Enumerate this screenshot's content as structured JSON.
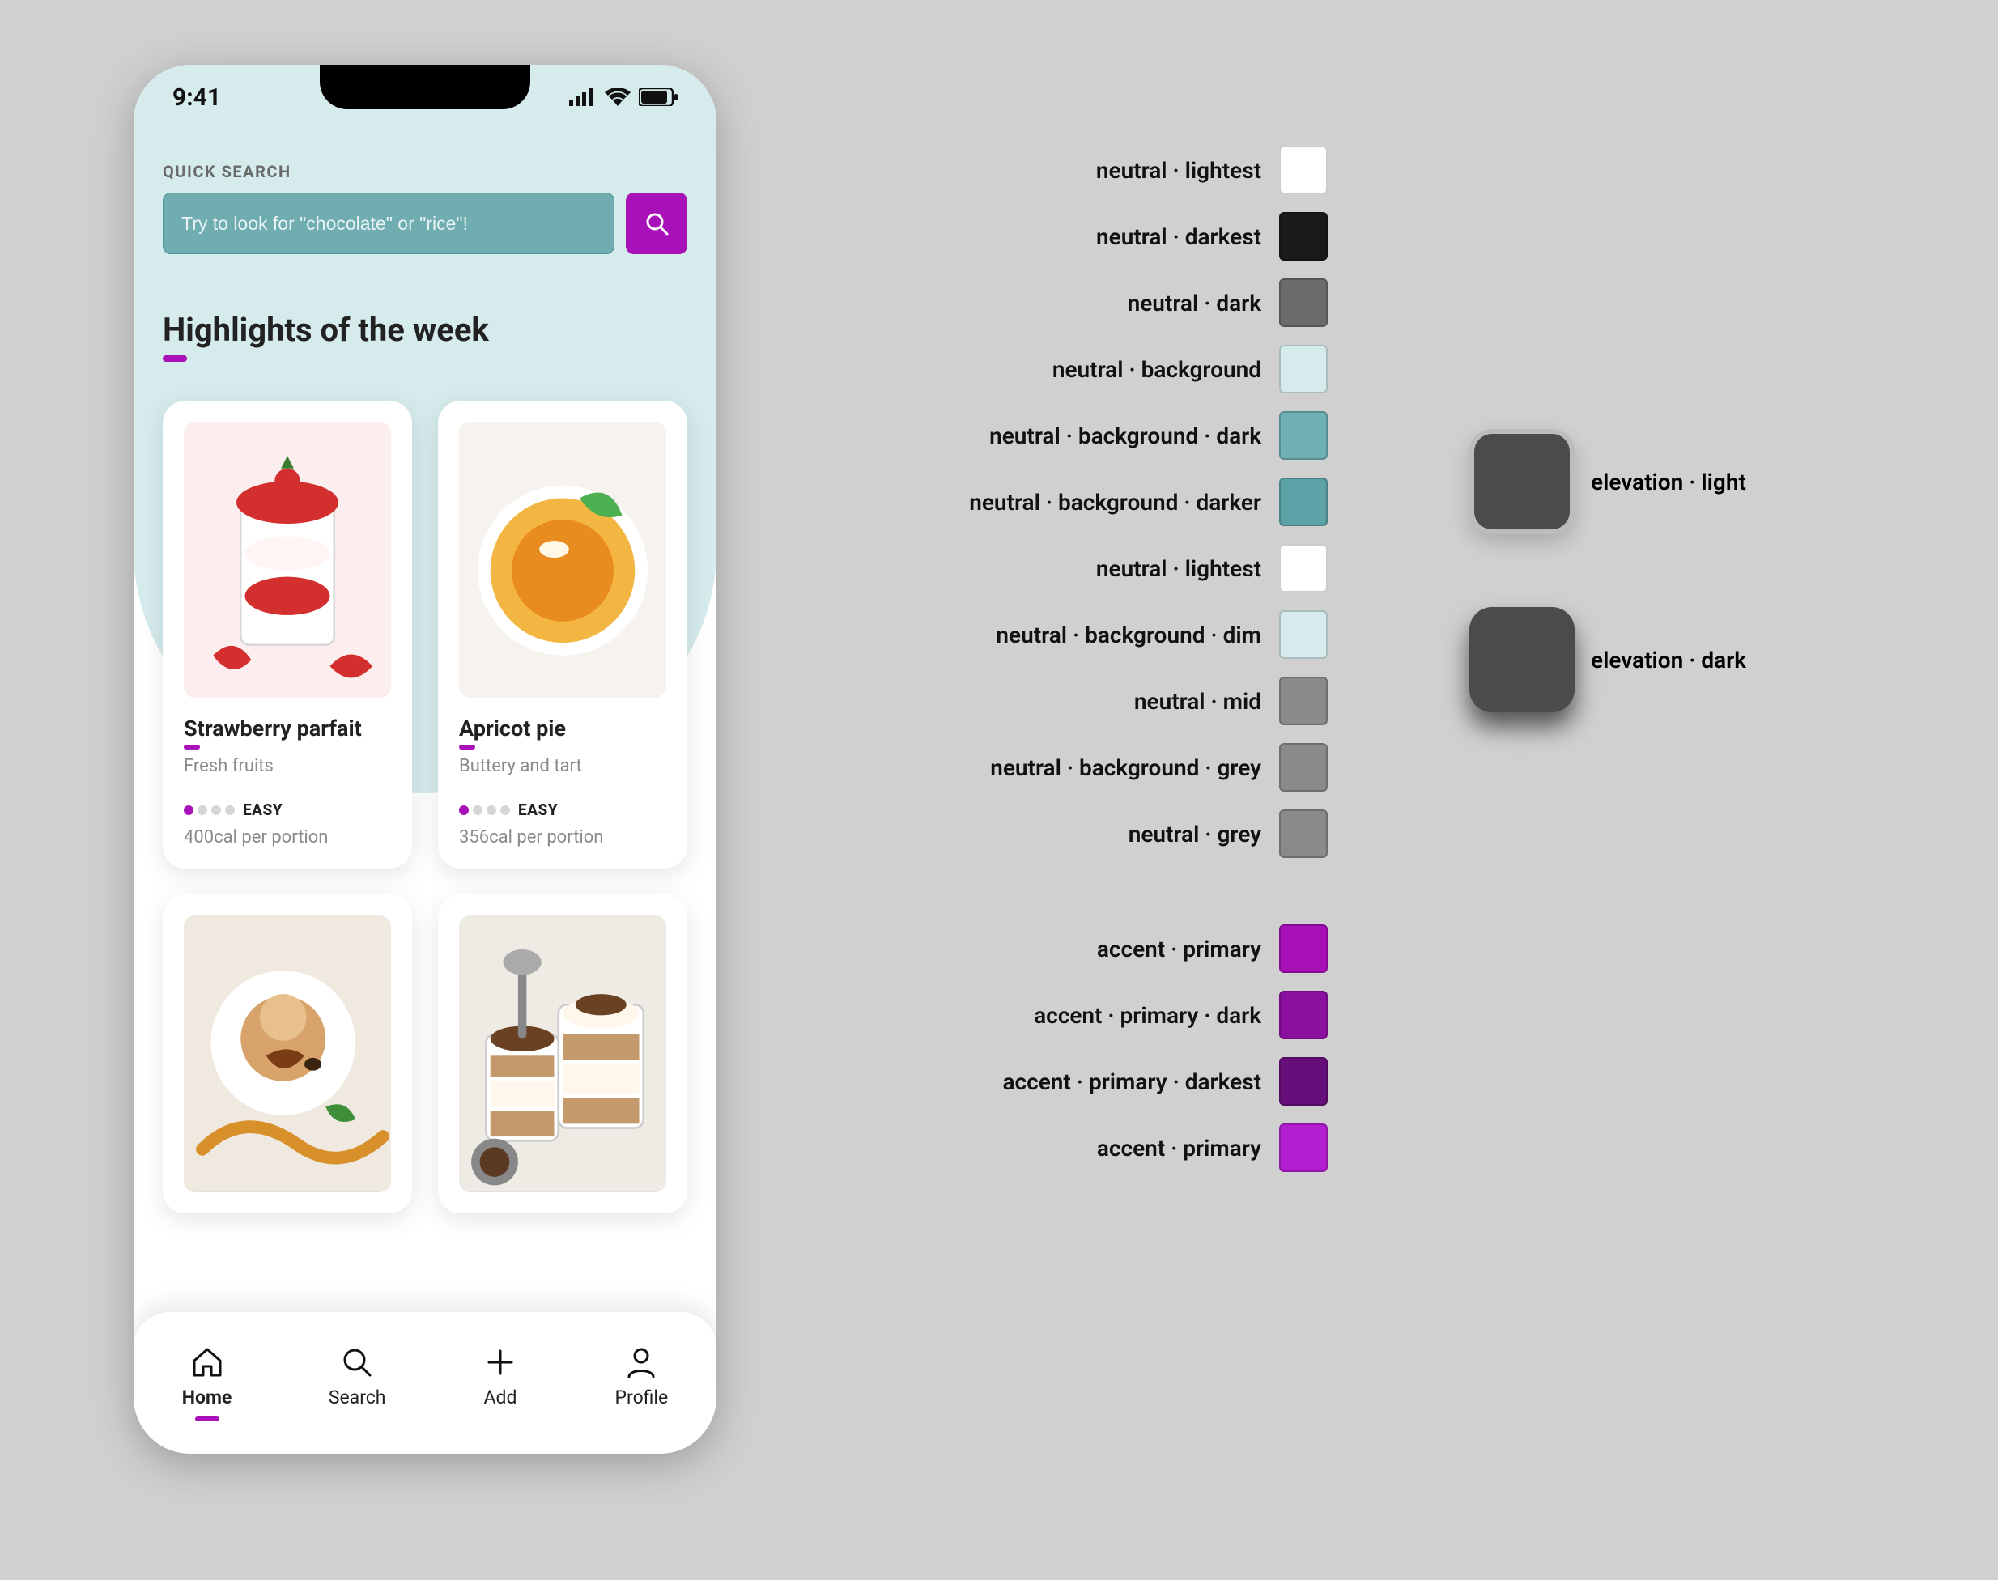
{
  "status": {
    "time": "9:41"
  },
  "search": {
    "label": "QUICK SEARCH",
    "placeholder": "Try to look for \"chocolate\" or \"rice\"!"
  },
  "section_title": "Highlights of the week",
  "cards": [
    {
      "title": "Strawberry parfait",
      "subtitle": "Fresh fruits",
      "difficulty_label": "EASY",
      "difficulty_dots": 1,
      "calories": "400cal per portion"
    },
    {
      "title": "Apricot pie",
      "subtitle": "Buttery and tart",
      "difficulty_label": "EASY",
      "difficulty_dots": 1,
      "calories": "356cal per portion"
    },
    {
      "title": "",
      "subtitle": "",
      "difficulty_label": "",
      "difficulty_dots": 0,
      "calories": ""
    },
    {
      "title": "",
      "subtitle": "",
      "difficulty_label": "",
      "difficulty_dots": 0,
      "calories": ""
    }
  ],
  "tabs": [
    {
      "label": "Home",
      "active": true
    },
    {
      "label": "Search",
      "active": false
    },
    {
      "label": "Add",
      "active": false
    },
    {
      "label": "Profile",
      "active": false
    }
  ],
  "palette": {
    "neutral.lightest": "#ffffff",
    "neutral.darkest": "#1a1a1a",
    "neutral.dark": "#6b6b6b",
    "neutral.background.original": "#d5ebec",
    "neutral.background.dark": "#6fb0b4",
    "neutral.background.darker": "#5ca2a6",
    "neutral.lightest.duplicate": "#ffffff",
    "neutral.background.dim": "#d5ebec",
    "neutral.mid": "#8a8a8a",
    "neutral.background.grey": "#8a8a8a",
    "neutral.grey": "#8a8a8a",
    "accent.primary": "#a810b8",
    "accent.primary.dark": "#8c10a0",
    "accent.primary.darkest": "#660f7a",
    "accent.primary.alt": "#b31ed0"
  },
  "palette_labels": {
    "r0": "neutral · lightest",
    "r1": "neutral · darkest",
    "r2": "neutral · dark",
    "r3": "neutral · background",
    "r4": "neutral · background · dark",
    "r5": "neutral · background · darker",
    "r6": "neutral · lightest",
    "r7": "neutral · background · dim",
    "r8": "neutral · mid",
    "r9": "neutral · background · grey",
    "r10": "neutral · grey",
    "r11": "accent · primary",
    "r12": "accent · primary · dark",
    "r13": "accent · primary · darkest",
    "r14": "accent · primary"
  },
  "elevation": {
    "light_label": "elevation · light",
    "dark_label": "elevation · dark"
  }
}
